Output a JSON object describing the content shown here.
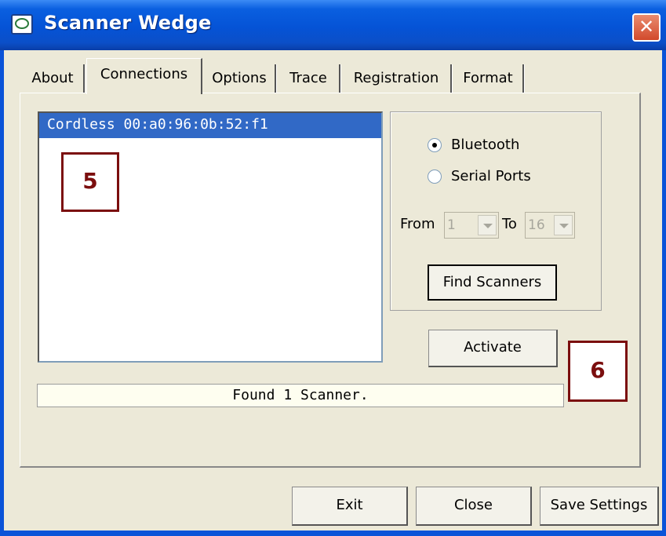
{
  "window": {
    "title": "Scanner Wedge",
    "close_glyph": "✕"
  },
  "tabs": [
    {
      "label": "About"
    },
    {
      "label": "Connections"
    },
    {
      "label": "Options"
    },
    {
      "label": "Trace"
    },
    {
      "label": "Registration"
    },
    {
      "label": "Format"
    }
  ],
  "active_tab": "Connections",
  "scanner_list": {
    "items": [
      "Cordless 00:a0:96:0b:52:f1"
    ],
    "selected_index": 0
  },
  "callouts": {
    "list_marker": "5",
    "activate_marker": "6"
  },
  "connection_type": {
    "options": [
      {
        "label": "Bluetooth",
        "selected": true
      },
      {
        "label": "Serial Ports",
        "selected": false
      }
    ]
  },
  "port_range": {
    "from_label": "From",
    "from_value": "1",
    "to_label": "To",
    "to_value": "16"
  },
  "buttons": {
    "find_scanners": "Find Scanners",
    "activate": "Activate",
    "exit": "Exit",
    "close": "Close",
    "save_settings": "Save Settings"
  },
  "status": "Found 1 Scanner.",
  "colors": {
    "titlebar": "#0553D6",
    "selection": "#3169C6",
    "callout": "#7B0E0E",
    "dialog_bg": "#ECE9D8"
  },
  "icons": {
    "app": "scanner-wedge-app-icon",
    "close": "close-icon",
    "dropdown": "chevron-down-icon"
  }
}
